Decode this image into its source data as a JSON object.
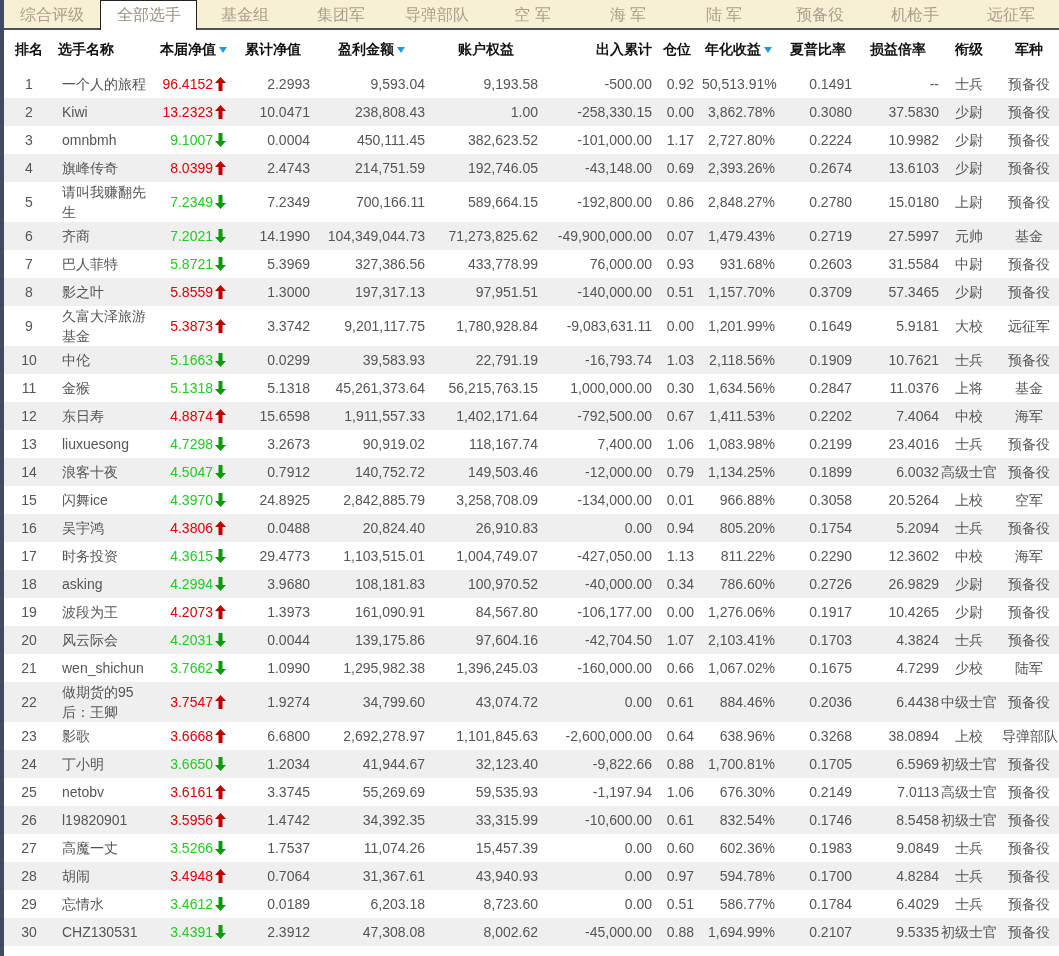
{
  "tabs": [
    {
      "label": "综合评级",
      "selected": false
    },
    {
      "label": "全部选手",
      "selected": true
    },
    {
      "label": "基金组",
      "selected": false
    },
    {
      "label": "集团军",
      "selected": false
    },
    {
      "label": "导弹部队",
      "selected": false
    },
    {
      "label": "空 军",
      "selected": false
    },
    {
      "label": "海 军",
      "selected": false
    },
    {
      "label": "陆 军",
      "selected": false
    },
    {
      "label": "预备役",
      "selected": false
    },
    {
      "label": "机枪手",
      "selected": false
    },
    {
      "label": "远征军",
      "selected": false
    }
  ],
  "table": {
    "columns": [
      {
        "label": "排名",
        "sorted": false
      },
      {
        "label": "选手名称",
        "sorted": false
      },
      {
        "label": "本届净值",
        "sorted": true
      },
      {
        "label": "累计净值",
        "sorted": false
      },
      {
        "label": "盈利金额",
        "sorted": true
      },
      {
        "label": "账户权益",
        "sorted": false
      },
      {
        "label": "出入累计",
        "sorted": false
      },
      {
        "label": "仓位",
        "sorted": false
      },
      {
        "label": "年化收益",
        "sorted": true
      },
      {
        "label": "夏普比率",
        "sorted": false
      },
      {
        "label": "损益倍率",
        "sorted": false
      },
      {
        "label": "衔级",
        "sorted": false
      },
      {
        "label": "军种",
        "sorted": false
      }
    ],
    "rows": [
      {
        "cells": [
          "1",
          "一个人的旅程",
          "96.4152",
          "2.2993",
          "9,593.04",
          "9,193.58",
          "-500.00",
          "0.92",
          "50,513.91%",
          "0.1491",
          "--",
          "士兵",
          "预备役"
        ],
        "rising": true
      },
      {
        "cells": [
          "2",
          "Kiwi",
          "13.2323",
          "10.0471",
          "238,808.43",
          "1.00",
          "-258,330.15",
          "0.00",
          "3,862.78%",
          "0.3080",
          "37.5830",
          "少尉",
          "预备役"
        ],
        "rising": true
      },
      {
        "cells": [
          "3",
          "omnbmh",
          "9.1007",
          "0.0004",
          "450,111.45",
          "382,623.52",
          "-101,000.00",
          "1.17",
          "2,727.80%",
          "0.2224",
          "10.9982",
          "少尉",
          "预备役"
        ],
        "rising": false
      },
      {
        "cells": [
          "4",
          "旗峰传奇",
          "8.0399",
          "2.4743",
          "214,751.59",
          "192,746.05",
          "-43,148.00",
          "0.69",
          "2,393.26%",
          "0.2674",
          "13.6103",
          "少尉",
          "预备役"
        ],
        "rising": true
      },
      {
        "cells": [
          "5",
          "请叫我赚翻先生",
          "7.2349",
          "7.2349",
          "700,166.11",
          "589,664.15",
          "-192,800.00",
          "0.86",
          "2,848.27%",
          "0.2780",
          "15.0180",
          "上尉",
          "预备役"
        ],
        "rising": false
      },
      {
        "cells": [
          "6",
          "齐商",
          "7.2021",
          "14.1990",
          "104,349,044.73",
          "71,273,825.62",
          "-49,900,000.00",
          "0.07",
          "1,479.43%",
          "0.2719",
          "27.5997",
          "元帅",
          "基金"
        ],
        "rising": false
      },
      {
        "cells": [
          "7",
          "巴人菲特",
          "5.8721",
          "5.3969",
          "327,386.56",
          "433,778.99",
          "76,000.00",
          "0.93",
          "931.68%",
          "0.2603",
          "31.5584",
          "中尉",
          "预备役"
        ],
        "rising": false
      },
      {
        "cells": [
          "8",
          "影之叶",
          "5.8559",
          "1.3000",
          "197,317.13",
          "97,951.51",
          "-140,000.00",
          "0.51",
          "1,157.70%",
          "0.3709",
          "57.3465",
          "少尉",
          "预备役"
        ],
        "rising": true
      },
      {
        "cells": [
          "9",
          "久富大泽旅游基金",
          "5.3873",
          "3.3742",
          "9,201,117.75",
          "1,780,928.84",
          "-9,083,631.11",
          "0.00",
          "1,201.99%",
          "0.1649",
          "5.9181",
          "大校",
          "远征军"
        ],
        "rising": true
      },
      {
        "cells": [
          "10",
          "中伦",
          "5.1663",
          "0.0299",
          "39,583.93",
          "22,791.19",
          "-16,793.74",
          "1.03",
          "2,118.56%",
          "0.1909",
          "10.7621",
          "士兵",
          "预备役"
        ],
        "rising": false
      },
      {
        "cells": [
          "11",
          "金猴",
          "5.1318",
          "5.1318",
          "45,261,373.64",
          "56,215,763.15",
          "1,000,000.00",
          "0.30",
          "1,634.56%",
          "0.2847",
          "11.0376",
          "上将",
          "基金"
        ],
        "rising": false
      },
      {
        "cells": [
          "12",
          "东日寿",
          "4.8874",
          "15.6598",
          "1,911,557.33",
          "1,402,171.64",
          "-792,500.00",
          "0.67",
          "1,411.53%",
          "0.2202",
          "7.4064",
          "中校",
          "海军"
        ],
        "rising": true
      },
      {
        "cells": [
          "13",
          "liuxuesong",
          "4.7298",
          "3.2673",
          "90,919.02",
          "118,167.74",
          "7,400.00",
          "1.06",
          "1,083.98%",
          "0.2199",
          "23.4016",
          "士兵",
          "预备役"
        ],
        "rising": false
      },
      {
        "cells": [
          "14",
          "浪客十夜",
          "4.5047",
          "0.7912",
          "140,752.72",
          "149,503.46",
          "-12,000.00",
          "0.79",
          "1,134.25%",
          "0.1899",
          "6.0032",
          "高级士官",
          "预备役"
        ],
        "rising": false
      },
      {
        "cells": [
          "15",
          "闪舞ice",
          "4.3970",
          "24.8925",
          "2,842,885.79",
          "3,258,708.09",
          "-134,000.00",
          "0.01",
          "966.88%",
          "0.3058",
          "20.5264",
          "上校",
          "空军"
        ],
        "rising": false
      },
      {
        "cells": [
          "16",
          "吴宇鸿",
          "4.3806",
          "0.0488",
          "20,824.40",
          "26,910.83",
          "0.00",
          "0.94",
          "805.20%",
          "0.1754",
          "5.2094",
          "士兵",
          "预备役"
        ],
        "rising": true
      },
      {
        "cells": [
          "17",
          "时务投资",
          "4.3615",
          "29.4773",
          "1,103,515.01",
          "1,004,749.07",
          "-427,050.00",
          "1.13",
          "811.22%",
          "0.2290",
          "12.3602",
          "中校",
          "海军"
        ],
        "rising": false
      },
      {
        "cells": [
          "18",
          "asking",
          "4.2994",
          "3.9680",
          "108,181.83",
          "100,970.52",
          "-40,000.00",
          "0.34",
          "786.60%",
          "0.2726",
          "26.9829",
          "少尉",
          "预备役"
        ],
        "rising": false
      },
      {
        "cells": [
          "19",
          "波段为王",
          "4.2073",
          "1.3973",
          "161,090.91",
          "84,567.80",
          "-106,177.00",
          "0.00",
          "1,276.06%",
          "0.1917",
          "10.4265",
          "少尉",
          "预备役"
        ],
        "rising": true
      },
      {
        "cells": [
          "20",
          "风云际会",
          "4.2031",
          "0.0044",
          "139,175.86",
          "97,604.16",
          "-42,704.50",
          "1.07",
          "2,103.41%",
          "0.1703",
          "4.3824",
          "士兵",
          "预备役"
        ],
        "rising": false
      },
      {
        "cells": [
          "21",
          "wen_shichun",
          "3.7662",
          "1.0990",
          "1,295,982.38",
          "1,396,245.03",
          "-160,000.00",
          "0.66",
          "1,067.02%",
          "0.1675",
          "4.7299",
          "少校",
          "陆军"
        ],
        "rising": false
      },
      {
        "cells": [
          "22",
          "做期货的95后：王卿",
          "3.7547",
          "1.9274",
          "34,799.60",
          "43,074.72",
          "0.00",
          "0.61",
          "884.46%",
          "0.2036",
          "6.4438",
          "中级士官",
          "预备役"
        ],
        "rising": true
      },
      {
        "cells": [
          "23",
          "影歌",
          "3.6668",
          "6.6800",
          "2,692,278.97",
          "1,101,845.63",
          "-2,600,000.00",
          "0.64",
          "638.96%",
          "0.3268",
          "38.0894",
          "上校",
          "导弹部队"
        ],
        "rising": true
      },
      {
        "cells": [
          "24",
          "丁小明",
          "3.6650",
          "1.2034",
          "41,944.67",
          "32,123.40",
          "-9,822.66",
          "0.88",
          "1,700.81%",
          "0.1705",
          "6.5969",
          "初级士官",
          "预备役"
        ],
        "rising": false
      },
      {
        "cells": [
          "25",
          "netobv",
          "3.6161",
          "3.3745",
          "55,269.69",
          "59,535.93",
          "-1,197.94",
          "1.06",
          "676.30%",
          "0.2149",
          "7.0113",
          "高级士官",
          "预备役"
        ],
        "rising": true
      },
      {
        "cells": [
          "26",
          "l19820901",
          "3.5956",
          "1.4742",
          "34,392.35",
          "33,315.99",
          "-10,600.00",
          "0.61",
          "832.54%",
          "0.1746",
          "8.5458",
          "初级士官",
          "预备役"
        ],
        "rising": true
      },
      {
        "cells": [
          "27",
          "高魔一丈",
          "3.5266",
          "1.7537",
          "11,074.26",
          "15,457.39",
          "0.00",
          "0.60",
          "602.36%",
          "0.1983",
          "9.0849",
          "士兵",
          "预备役"
        ],
        "rising": false
      },
      {
        "cells": [
          "28",
          "胡闹",
          "3.4948",
          "0.7064",
          "31,367.61",
          "43,940.93",
          "0.00",
          "0.97",
          "594.78%",
          "0.1700",
          "4.8284",
          "士兵",
          "预备役"
        ],
        "rising": true
      },
      {
        "cells": [
          "29",
          "忘情水",
          "3.4612",
          "0.0189",
          "6,203.18",
          "8,723.60",
          "0.00",
          "0.51",
          "586.77%",
          "0.1784",
          "6.4029",
          "士兵",
          "预备役"
        ],
        "rising": false
      },
      {
        "cells": [
          "30",
          "CHZ130531",
          "3.4391",
          "2.3912",
          "47,308.08",
          "8,002.62",
          "-45,000.00",
          "0.88",
          "1,694.99%",
          "0.2107",
          "9.5335",
          "初级士官",
          "预备役"
        ],
        "rising": false
      }
    ]
  }
}
